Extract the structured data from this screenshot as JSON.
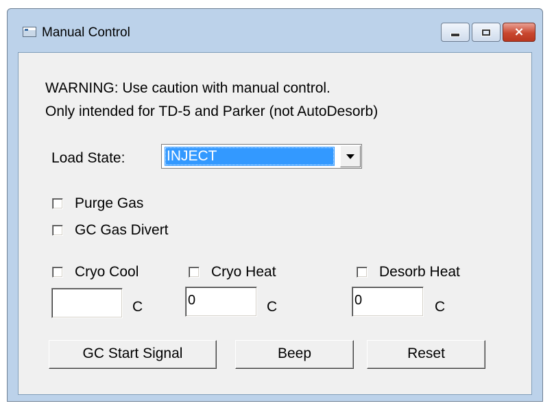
{
  "window": {
    "title": "Manual Control",
    "icon": "app-window-icon",
    "controls": {
      "minimize": "minimize-icon",
      "maximize": "maximize-icon",
      "close": "×"
    }
  },
  "warning": {
    "line1": "WARNING: Use caution with manual control.",
    "line2": "Only intended for TD-5 and Parker (not AutoDesorb)"
  },
  "load_state": {
    "label": "Load State:",
    "value": "INJECT"
  },
  "checkboxes": {
    "purge_gas": {
      "label": "Purge Gas",
      "checked": false
    },
    "gc_gas_divert": {
      "label": "GC Gas Divert",
      "checked": false
    },
    "cryo_cool": {
      "label": "Cryo Cool",
      "checked": false
    },
    "cryo_heat": {
      "label": "Cryo Heat",
      "checked": false
    },
    "desorb_heat": {
      "label": "Desorb Heat",
      "checked": false
    }
  },
  "temperatures": {
    "cryo_cool": {
      "value": "",
      "unit": "C"
    },
    "cryo_heat": {
      "value": "0",
      "unit": "C"
    },
    "desorb_heat": {
      "value": "0",
      "unit": "C"
    }
  },
  "buttons": {
    "gc_start": "GC Start Signal",
    "beep": "Beep",
    "reset": "Reset"
  },
  "colors": {
    "selection": "#3399ff",
    "client_bg": "#f0f0f0",
    "frame": "#bcd2ea",
    "close_button": "#c9472f"
  }
}
